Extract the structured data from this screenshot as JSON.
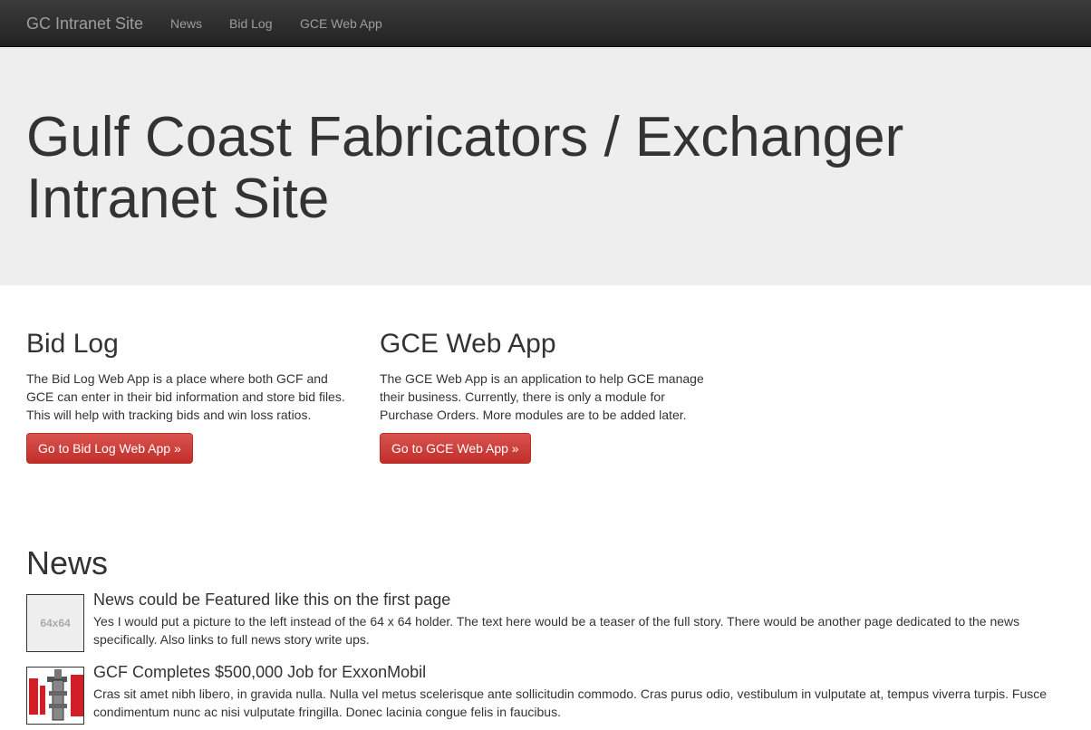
{
  "navbar": {
    "brand": "GC Intranet Site",
    "links": [
      "News",
      "Bid Log",
      "GCE Web App"
    ]
  },
  "jumbotron": {
    "title": "Gulf Coast Fabricators / Exchanger Intranet Site"
  },
  "columns": [
    {
      "heading": "Bid Log",
      "text": "The Bid Log Web App is a place where both GCF and GCE can enter in their bid information and store bid files. This will help with tracking bids and win loss ratios.",
      "button": "Go to Bid Log Web App »"
    },
    {
      "heading": "GCE Web App",
      "text": "The GCE Web App is an application to help GCE manage their business. Currently, there is only a module for Purchase Orders. More modules are to be added later.",
      "button": "Go to GCE Web App »"
    }
  ],
  "news": {
    "title": "News",
    "items": [
      {
        "thumb_text": "64x64",
        "headline": "News could be Featured like this on the first page",
        "body": "Yes I would put a picture to the left instead of the 64 x 64 holder. The text here would be a teaser of the full story. There would be another page dedicated to the news specifically. Also links to full news story write ups."
      },
      {
        "thumb_text": "",
        "headline": "GCF Completes $500,000 Job for ExxonMobil",
        "body": "Cras sit amet nibh libero, in gravida nulla. Nulla vel metus scelerisque ante sollicitudin commodo. Cras purus odio, vestibulum in vulputate at, tempus viverra turpis. Fusce condimentum nunc ac nisi vulputate fringilla. Donec lacinia congue felis in faucibus."
      }
    ]
  },
  "colors": {
    "navbar_bg": "#222222",
    "jumbotron_bg": "#eeeeee",
    "button_red": "#d9534f",
    "logo_red": "#d21f26"
  }
}
